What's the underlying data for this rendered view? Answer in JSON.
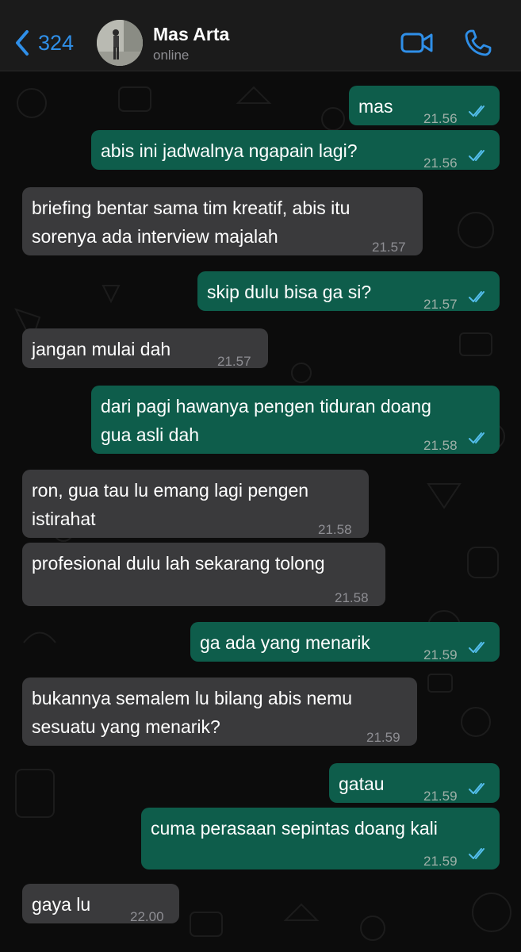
{
  "header": {
    "back_count": "324",
    "contact_name": "Mas Arta",
    "status": "online",
    "icons": [
      "chevron-left-icon",
      "video-call-icon",
      "phone-icon"
    ],
    "accent_color": "#2f8fe8"
  },
  "colors": {
    "outgoing_bubble": "#0e5d4b",
    "incoming_bubble": "#3a3a3c",
    "read_ticks": "#53bdeb"
  },
  "messages": [
    {
      "dir": "out",
      "text": "mas",
      "time": "21.56",
      "read": true
    },
    {
      "dir": "out",
      "text": "abis ini jadwalnya ngapain lagi?",
      "time": "21.56",
      "read": true
    },
    {
      "dir": "in",
      "lines": [
        "briefing bentar sama tim kreatif, abis itu",
        "sorenya ada interview majalah"
      ],
      "time": "21.57"
    },
    {
      "dir": "out",
      "text": "skip dulu bisa ga si?",
      "time": "21.57",
      "read": true
    },
    {
      "dir": "in",
      "text": "jangan mulai dah",
      "time": "21.57"
    },
    {
      "dir": "out",
      "lines": [
        "dari pagi hawanya pengen tiduran doang",
        "gua asli dah"
      ],
      "time": "21.58",
      "read": true
    },
    {
      "dir": "in",
      "lines": [
        "ron, gua tau lu emang lagi pengen",
        "istirahat"
      ],
      "time": "21.58"
    },
    {
      "dir": "in",
      "text": "profesional dulu lah sekarang tolong",
      "time": "21.58"
    },
    {
      "dir": "out",
      "text": "ga ada yang menarik",
      "time": "21.59",
      "read": true
    },
    {
      "dir": "in",
      "lines": [
        "bukannya semalem lu bilang abis nemu",
        "sesuatu yang menarik?"
      ],
      "time": "21.59"
    },
    {
      "dir": "out",
      "text": "gatau",
      "time": "21.59",
      "read": true
    },
    {
      "dir": "out",
      "text": "cuma perasaan sepintas doang kali",
      "time": "21.59",
      "read": true
    },
    {
      "dir": "in",
      "text": "gaya lu",
      "time": "22.00"
    }
  ]
}
